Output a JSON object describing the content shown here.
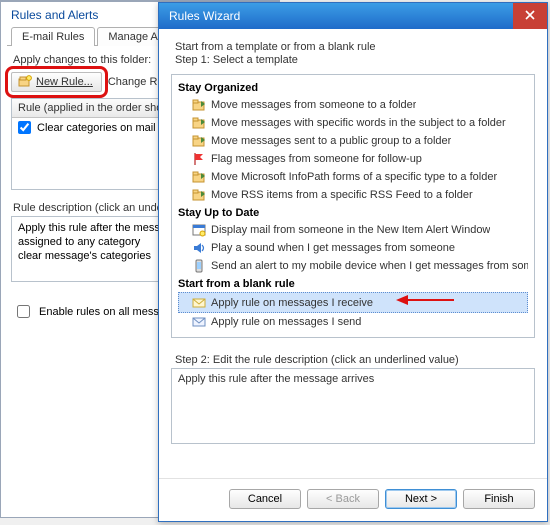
{
  "back": {
    "title": "Rules and Alerts",
    "tabs": [
      "E-mail Rules",
      "Manage Alerts"
    ],
    "apply_changes_label": "Apply changes to this folder:",
    "new_rule_label": "New Rule...",
    "change_rule_label": "Change Rule",
    "list_header": "Rule (applied in the order shown)",
    "list_item": "Clear categories on mail (recommended)",
    "desc_label": "Rule description (click an underlined value to edit):",
    "desc_lines": [
      "Apply this rule after the message arrives",
      "assigned to any category",
      "clear message's categories"
    ],
    "enable_all_label": "Enable rules on all messages downloaded from RSS Feeds"
  },
  "wizard": {
    "title": "Rules Wizard",
    "intro": "Start from a template or from a blank rule",
    "step1_label": "Step 1: Select a template",
    "sections": {
      "stay_organized": {
        "header": "Stay Organized",
        "items": [
          {
            "icon": "move-folder-icon",
            "label": "Move messages from someone to a folder"
          },
          {
            "icon": "move-folder-icon",
            "label": "Move messages with specific words in the subject to a folder"
          },
          {
            "icon": "move-folder-icon",
            "label": "Move messages sent to a public group to a folder"
          },
          {
            "icon": "flag-icon",
            "label": "Flag messages from someone for follow-up"
          },
          {
            "icon": "move-folder-icon",
            "label": "Move Microsoft InfoPath forms of a specific type to a folder"
          },
          {
            "icon": "move-folder-icon",
            "label": "Move RSS items from a specific RSS Feed to a folder"
          }
        ]
      },
      "stay_up": {
        "header": "Stay Up to Date",
        "items": [
          {
            "icon": "alert-window-icon",
            "label": "Display mail from someone in the New Item Alert Window"
          },
          {
            "icon": "sound-icon",
            "label": "Play a sound when I get messages from someone"
          },
          {
            "icon": "mobile-icon",
            "label": "Send an alert to my mobile device when I get messages from someone"
          }
        ]
      },
      "blank": {
        "header": "Start from a blank rule",
        "items": [
          {
            "icon": "envelope-in-icon",
            "label": "Apply rule on messages I receive",
            "selected": true
          },
          {
            "icon": "envelope-out-icon",
            "label": "Apply rule on messages I send"
          }
        ]
      }
    },
    "step2_label": "Step 2: Edit the rule description (click an underlined value)",
    "step2_text": "Apply this rule after the message arrives",
    "buttons": {
      "cancel": "Cancel",
      "back": "< Back",
      "next": "Next >",
      "finish": "Finish"
    }
  }
}
